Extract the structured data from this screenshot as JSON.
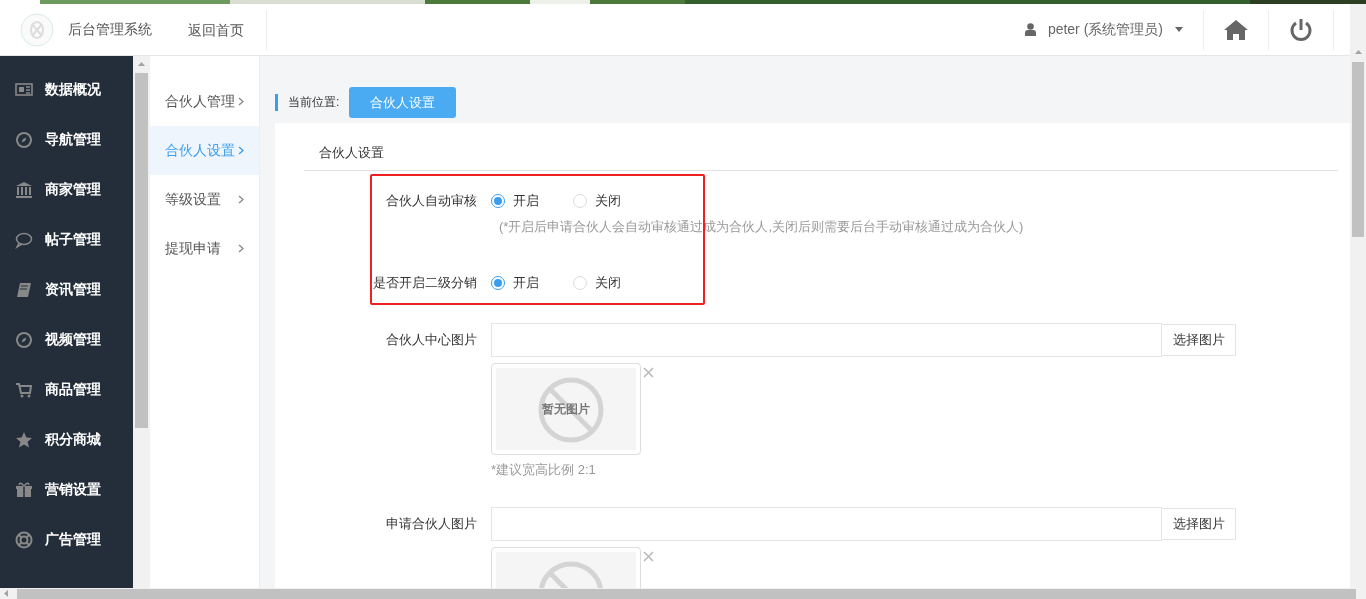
{
  "header": {
    "title": "后台管理系统",
    "home_link": "返回首页",
    "user": "peter (系统管理员)"
  },
  "sidebar": {
    "items": [
      {
        "label": "数据概况"
      },
      {
        "label": "导航管理"
      },
      {
        "label": "商家管理"
      },
      {
        "label": "帖子管理"
      },
      {
        "label": "资讯管理"
      },
      {
        "label": "视频管理"
      },
      {
        "label": "商品管理"
      },
      {
        "label": "积分商城"
      },
      {
        "label": "营销设置"
      },
      {
        "label": "广告管理"
      }
    ]
  },
  "submenu": [
    {
      "label": "合伙人管理",
      "selected": false
    },
    {
      "label": "合伙人设置",
      "selected": true
    },
    {
      "label": "等级设置",
      "selected": false
    },
    {
      "label": "提现申请",
      "selected": false
    }
  ],
  "breadcrumb": {
    "label": "当前位置:",
    "current": "合伙人设置"
  },
  "card": {
    "title": "合伙人设置"
  },
  "highlighted": true,
  "radio_groups": [
    {
      "label": "合伙人自动审核",
      "options": [
        {
          "label": "开启",
          "selected": true
        },
        {
          "label": "关闭",
          "selected": false
        }
      ],
      "hint": "(*开启后申请合伙人会自动审核通过成为合伙人,关闭后则需要后台手动审核通过成为合伙人)"
    },
    {
      "label": "是否开启二级分销",
      "options": [
        {
          "label": "开启",
          "selected": true
        },
        {
          "label": "关闭",
          "selected": false
        }
      ]
    }
  ],
  "image_fields": [
    {
      "label": "合伙人中心图片",
      "button": "选择图片",
      "preview": "暂无图片",
      "note": "*建议宽高比例 2:1"
    },
    {
      "label": "申请合伙人图片",
      "button": "选择图片"
    }
  ]
}
